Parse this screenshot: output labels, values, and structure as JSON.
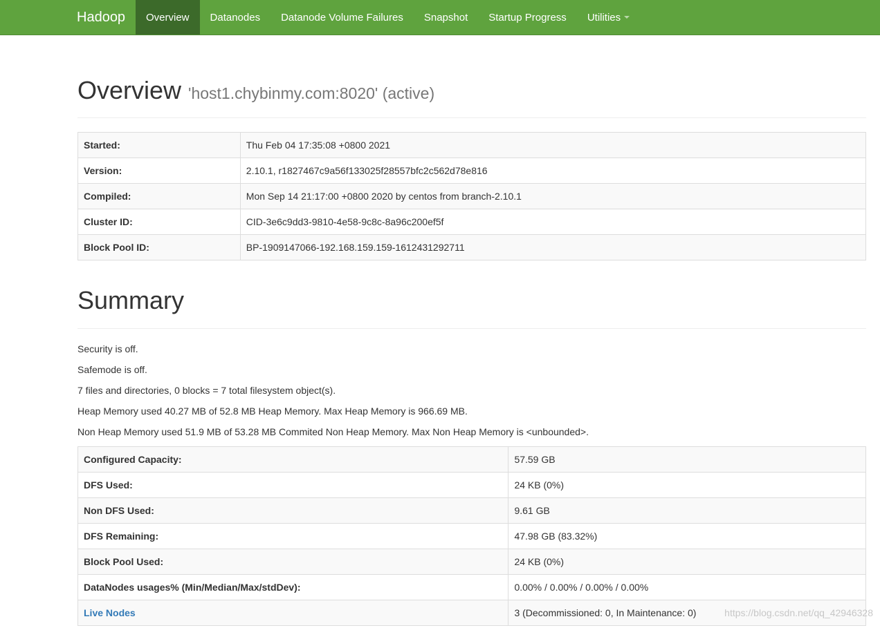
{
  "navbar": {
    "brand": "Hadoop",
    "items": [
      {
        "label": "Overview",
        "active": true
      },
      {
        "label": "Datanodes"
      },
      {
        "label": "Datanode Volume Failures"
      },
      {
        "label": "Snapshot"
      },
      {
        "label": "Startup Progress"
      },
      {
        "label": "Utilities",
        "dropdown": true
      }
    ]
  },
  "overview": {
    "title": "Overview",
    "subtitle": "'host1.chybinmy.com:8020' (active)",
    "rows": [
      {
        "label": "Started:",
        "value": "Thu Feb 04 17:35:08 +0800 2021"
      },
      {
        "label": "Version:",
        "value": "2.10.1, r1827467c9a56f133025f28557bfc2c562d78e816"
      },
      {
        "label": "Compiled:",
        "value": "Mon Sep 14 21:17:00 +0800 2020 by centos from branch-2.10.1"
      },
      {
        "label": "Cluster ID:",
        "value": "CID-3e6c9dd3-9810-4e58-9c8c-8a96c200ef5f"
      },
      {
        "label": "Block Pool ID:",
        "value": "BP-1909147066-192.168.159.159-1612431292711"
      }
    ]
  },
  "summary": {
    "title": "Summary",
    "lines": [
      "Security is off.",
      "Safemode is off.",
      "7 files and directories, 0 blocks = 7 total filesystem object(s).",
      "Heap Memory used 40.27 MB of 52.8 MB Heap Memory. Max Heap Memory is 966.69 MB.",
      "Non Heap Memory used 51.9 MB of 53.28 MB Commited Non Heap Memory. Max Non Heap Memory is <unbounded>."
    ],
    "rows": [
      {
        "label": "Configured Capacity:",
        "value": "57.59 GB"
      },
      {
        "label": "DFS Used:",
        "value": "24 KB (0%)"
      },
      {
        "label": "Non DFS Used:",
        "value": "9.61 GB"
      },
      {
        "label": "DFS Remaining:",
        "value": "47.98 GB (83.32%)"
      },
      {
        "label": "Block Pool Used:",
        "value": "24 KB (0%)"
      },
      {
        "label": "DataNodes usages% (Min/Median/Max/stdDev):",
        "value": "0.00% / 0.00% / 0.00% / 0.00%"
      },
      {
        "label": "Live Nodes",
        "value": "3 (Decommissioned: 0, In Maintenance: 0)",
        "link": true
      }
    ]
  },
  "watermark": "https://blog.csdn.net/qq_42946328"
}
